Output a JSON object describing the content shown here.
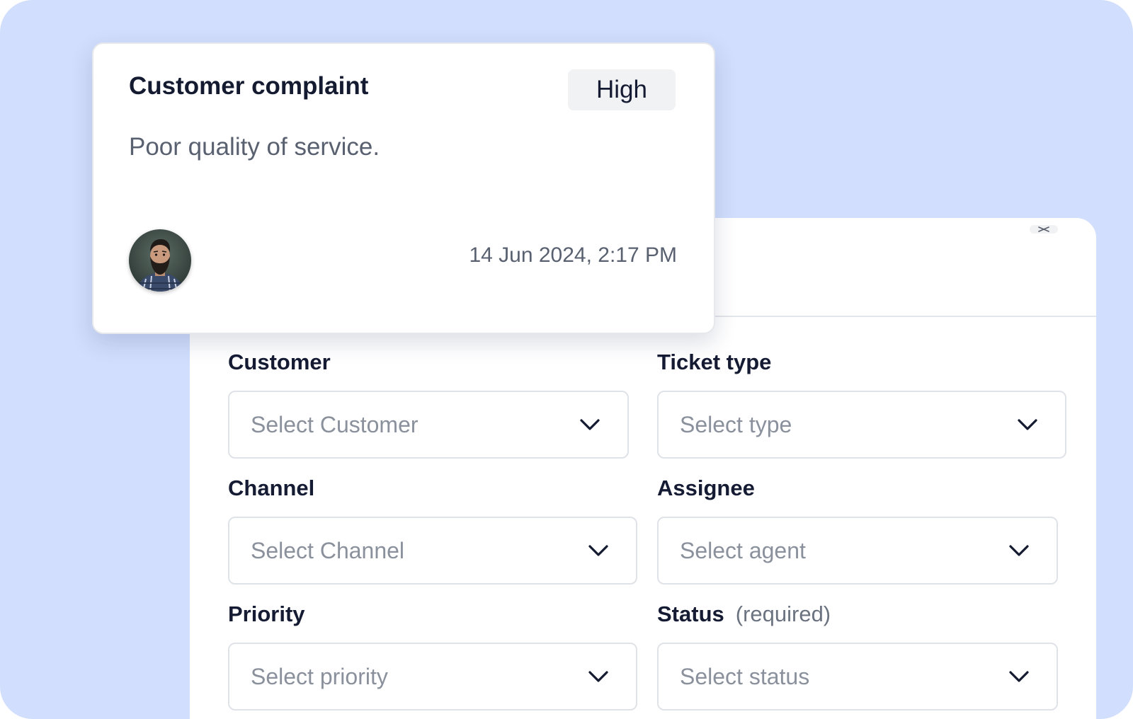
{
  "colors": {
    "background": "#d1defd",
    "panel": "#ffffff",
    "label_text": "#151b33",
    "placeholder_text": "#8a919c",
    "border": "#dfe3e8",
    "badge_background": "#f1f2f4"
  },
  "ticket_card": {
    "title": "Customer complaint",
    "priority_badge": "High",
    "description": "Poor quality of service.",
    "timestamp": "14 Jun 2024, 2:17 PM",
    "avatar_icon": "user-avatar-photo"
  },
  "form": {
    "close_icon": "close-icon",
    "fields": {
      "customer": {
        "label": "Customer",
        "placeholder": "Select Customer",
        "icon": "chevron-down-icon"
      },
      "ticket_type": {
        "label": "Ticket type",
        "placeholder": "Select type",
        "icon": "chevron-down-icon"
      },
      "channel": {
        "label": "Channel",
        "placeholder": "Select Channel",
        "icon": "chevron-down-icon"
      },
      "assignee": {
        "label": "Assignee",
        "placeholder": "Select agent",
        "icon": "chevron-down-icon"
      },
      "priority": {
        "label": "Priority",
        "placeholder": "Select priority",
        "icon": "chevron-down-icon"
      },
      "status": {
        "label": "Status",
        "hint": "(required)",
        "placeholder": "Select status",
        "icon": "chevron-down-icon"
      }
    }
  }
}
